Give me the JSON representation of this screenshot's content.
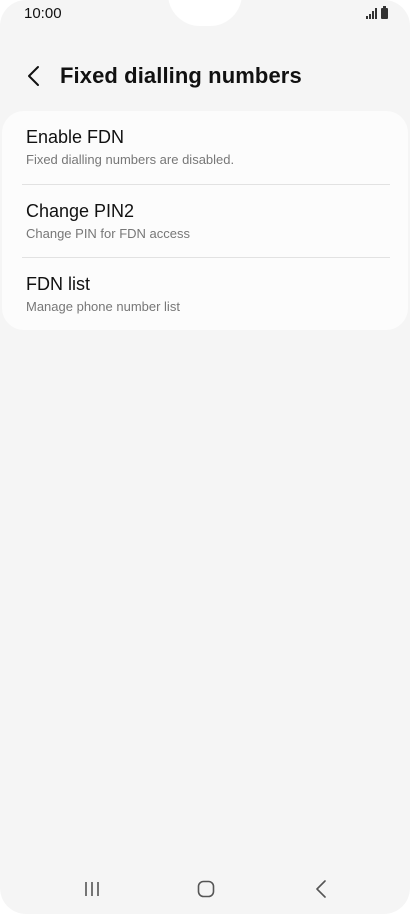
{
  "status_bar": {
    "time": "10:00",
    "icons": [
      "signal-icon",
      "battery-icon"
    ]
  },
  "header": {
    "back_icon": "chevron-left-icon",
    "title": "Fixed dialling numbers"
  },
  "settings": {
    "items": [
      {
        "title": "Enable FDN",
        "subtitle": "Fixed dialling numbers are disabled."
      },
      {
        "title": "Change PIN2",
        "subtitle": "Change PIN for FDN access"
      },
      {
        "title": "FDN list",
        "subtitle": "Manage phone number list"
      }
    ]
  },
  "nav_bar": {
    "buttons": [
      "recent-apps-icon",
      "home-icon",
      "back-icon"
    ]
  },
  "colors": {
    "background": "#f5f5f5",
    "card": "#fcfcfc",
    "subtitle": "#777777",
    "divider": "#e2e2e2"
  }
}
